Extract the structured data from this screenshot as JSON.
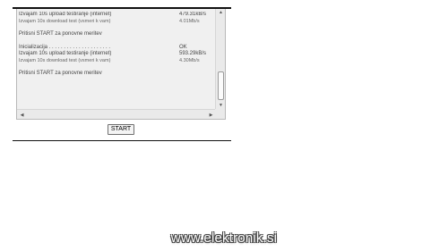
{
  "log": {
    "lines": [
      {
        "label": "Izvajam 10s upload testiranje (internet)",
        "value": "479.31kB/s",
        "sub": false
      },
      {
        "label": "Izvajam 10s download test (vsmeri k vam)",
        "value": "4.01Mb/s",
        "sub": true
      },
      {
        "label": "",
        "value": "",
        "sub": false,
        "gap": true
      },
      {
        "label": "Pritisni START za ponovne meritev",
        "value": "",
        "sub": false
      },
      {
        "label": "",
        "value": "",
        "sub": false,
        "gap": true
      },
      {
        "label": "Inicializacija . . . . . . . . . . . . . . . . . . . . .",
        "value": "OK",
        "sub": false
      },
      {
        "label": "Izvajam 10s upload testiranje (internet)",
        "value": "593.29kB/s",
        "sub": false
      },
      {
        "label": "Izvajam 10s download test (vsmeri k vam)",
        "value": "4.30Mb/s",
        "sub": true
      },
      {
        "label": "",
        "value": "",
        "sub": false,
        "gap": true
      },
      {
        "label": "Pritisni START za ponovne meritev",
        "value": "",
        "sub": false
      }
    ]
  },
  "controls": {
    "start_label": "START"
  },
  "icons": {
    "scroll_up": "scroll-up-arrow-icon",
    "scroll_down": "scroll-down-arrow-icon",
    "scroll_left": "scroll-left-arrow-icon",
    "scroll_right": "scroll-right-arrow-icon"
  },
  "footer": {
    "watermark": "www.elektronik.si"
  }
}
